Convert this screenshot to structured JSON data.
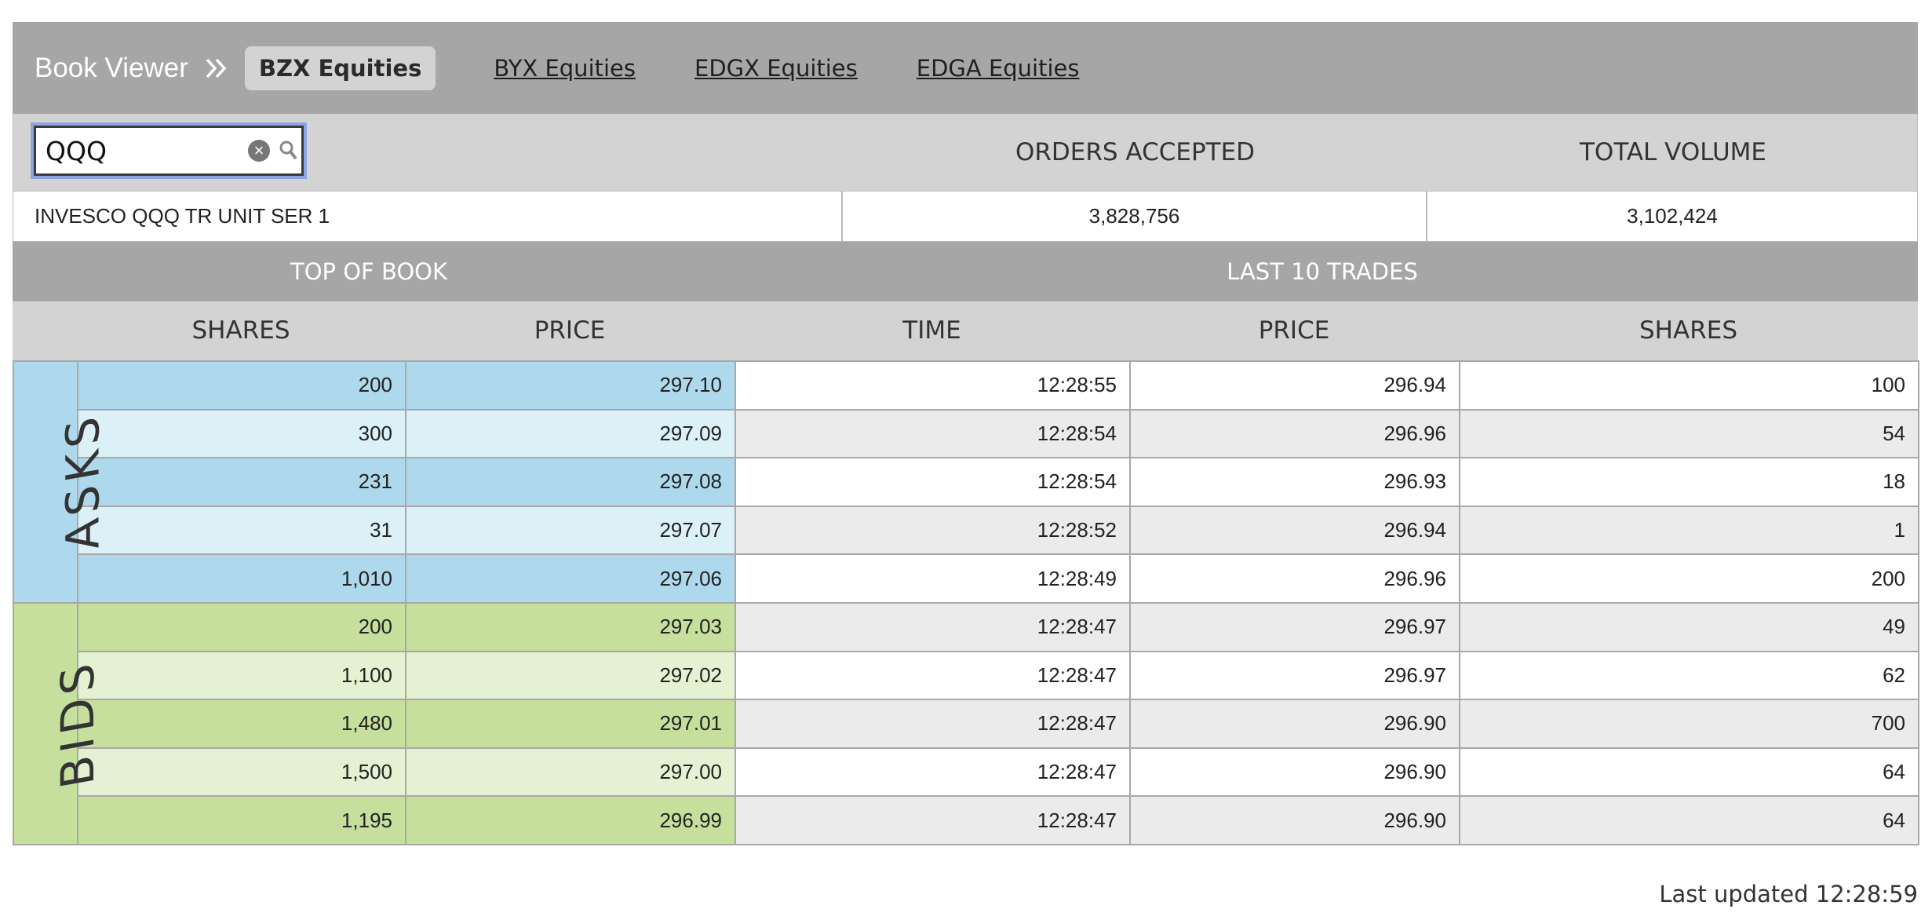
{
  "header": {
    "brand": "Book Viewer",
    "active_tab": "BZX Equities",
    "tabs": [
      "BYX Equities",
      "EDGX Equities",
      "EDGA Equities"
    ]
  },
  "search": {
    "value": "QQQ"
  },
  "stats": {
    "orders_label": "ORDERS ACCEPTED",
    "volume_label": "TOTAL VOLUME",
    "name": "INVESCO QQQ TR UNIT SER 1",
    "orders": "3,828,756",
    "volume": "3,102,424"
  },
  "sections": {
    "top_of_book": "TOP OF BOOK",
    "last_trades": "LAST 10 TRADES"
  },
  "columns": {
    "shares": "SHARES",
    "price": "PRICE",
    "time": "TIME",
    "trade_price": "PRICE",
    "trade_shares": "SHARES"
  },
  "sides": {
    "asks": "ASKS",
    "bids": "BIDS"
  },
  "asks": [
    {
      "shares": "200",
      "price": "297.10"
    },
    {
      "shares": "300",
      "price": "297.09"
    },
    {
      "shares": "231",
      "price": "297.08"
    },
    {
      "shares": "31",
      "price": "297.07"
    },
    {
      "shares": "1,010",
      "price": "297.06"
    }
  ],
  "bids": [
    {
      "shares": "200",
      "price": "297.03"
    },
    {
      "shares": "1,100",
      "price": "297.02"
    },
    {
      "shares": "1,480",
      "price": "297.01"
    },
    {
      "shares": "1,500",
      "price": "297.00"
    },
    {
      "shares": "1,195",
      "price": "296.99"
    }
  ],
  "trades": [
    {
      "time": "12:28:55",
      "price": "296.94",
      "shares": "100"
    },
    {
      "time": "12:28:54",
      "price": "296.96",
      "shares": "54"
    },
    {
      "time": "12:28:54",
      "price": "296.93",
      "shares": "18"
    },
    {
      "time": "12:28:52",
      "price": "296.94",
      "shares": "1"
    },
    {
      "time": "12:28:49",
      "price": "296.96",
      "shares": "200"
    },
    {
      "time": "12:28:47",
      "price": "296.97",
      "shares": "49"
    },
    {
      "time": "12:28:47",
      "price": "296.97",
      "shares": "62"
    },
    {
      "time": "12:28:47",
      "price": "296.90",
      "shares": "700"
    },
    {
      "time": "12:28:47",
      "price": "296.90",
      "shares": "64"
    },
    {
      "time": "12:28:47",
      "price": "296.90",
      "shares": "64"
    }
  ],
  "footer": {
    "last_updated": "Last updated 12:28:59"
  },
  "icons": {
    "chevron": "double-chevron-right-icon",
    "clear": "clear-icon",
    "search": "search-icon"
  },
  "colors": {
    "asks": "#aed8ec",
    "asks_alt": "#dcf0f8",
    "bids": "#c6df9c",
    "bids_alt": "#e4f2d3",
    "bar": "#a6a6a6",
    "subbar": "#d3d3d3",
    "search_focus": "#8da4e2"
  }
}
